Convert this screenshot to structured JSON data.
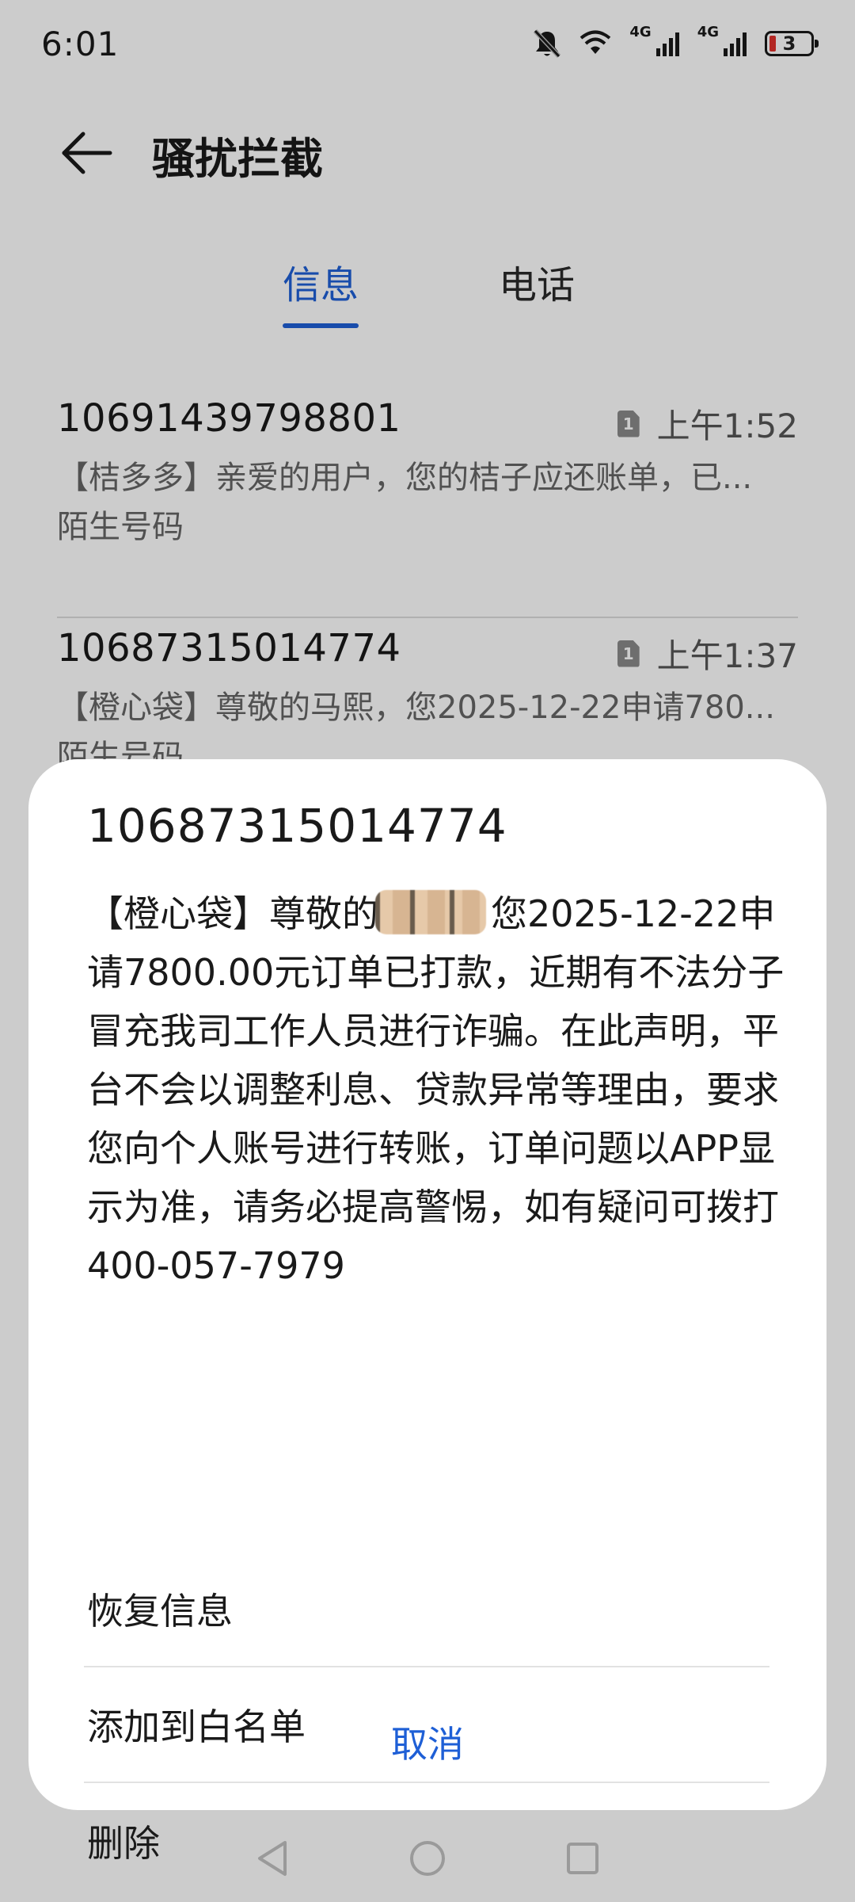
{
  "status_bar": {
    "time": "6:01",
    "network_1": "4G",
    "network_2": "4G",
    "battery_level": "3",
    "icons": [
      "bell-off-icon",
      "wifi-icon",
      "signal-icon",
      "signal-icon",
      "battery-icon"
    ]
  },
  "header": {
    "title": "骚扰拦截",
    "back_icon": "back-arrow-icon"
  },
  "tabs": [
    {
      "label": "信息",
      "active": true
    },
    {
      "label": "电话",
      "active": false
    }
  ],
  "messages": [
    {
      "number": "10691439798801",
      "sim": "1",
      "time": "上午1:52",
      "preview": "【桔多多】亲爱的用户，您的桔子应还账单，已...",
      "tag": "陌生号码"
    },
    {
      "number": "10687315014774",
      "sim": "1",
      "time": "上午1:37",
      "preview": "【橙心袋】尊敬的马熙，您2025-12-22申请780...",
      "tag": "陌生号码"
    }
  ],
  "sheet": {
    "title": "10687315014774",
    "body_before": "【橙心袋】尊敬的",
    "body_after": "您2025-12-22申请7800.00元订单已打款，近期有不法分子冒充我司工作人员进行诈骗。在此声明，平台不会以调整利息、贷款异常等理由，要求您向个人账号进行转账，订单问题以APP显示为准，请务必提高警惕，如有疑问可拨打400-057-7979",
    "actions": [
      "恢复信息",
      "添加到白名单",
      "删除"
    ],
    "cancel": "取消"
  },
  "colors": {
    "accent": "#1e5fd6",
    "scrim": "rgba(0,0,0,0.2)",
    "battery_low": "#e0312c"
  }
}
